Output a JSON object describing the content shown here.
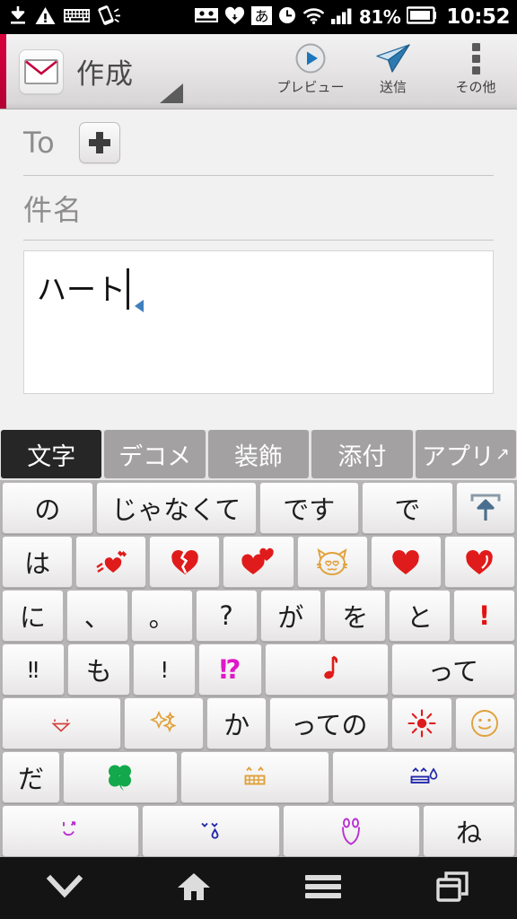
{
  "statusbar": {
    "left_icons": [
      {
        "name": "download-icon"
      },
      {
        "name": "warning-icon"
      },
      {
        "name": "keyboard-icon"
      },
      {
        "name": "vibrate-icon"
      }
    ],
    "right_icons": [
      {
        "name": "voicemail-icon"
      },
      {
        "name": "heart-icon"
      },
      {
        "name": "ime-japanese-icon",
        "glyph": "あ"
      },
      {
        "name": "alarm-clock-icon"
      },
      {
        "name": "wifi-icon"
      },
      {
        "name": "signal-icon"
      }
    ],
    "battery_percent": "81%",
    "clock": "10:52"
  },
  "appbar": {
    "title": "作成",
    "accent_color": "#d8003c",
    "actions": [
      {
        "label": "プレビュー",
        "icon": "play-circle-icon"
      },
      {
        "label": "送信",
        "icon": "send-paperplane-icon"
      },
      {
        "label": "その他",
        "icon": "overflow-dots-icon"
      }
    ]
  },
  "compose": {
    "to_label": "To",
    "to_value": "",
    "add_recipient_label": "+",
    "subject_placeholder": "件名",
    "subject_value": "",
    "body_value": "ハート"
  },
  "ime": {
    "tabs": [
      {
        "label": "文字",
        "active": true
      },
      {
        "label": "デコメ",
        "active": false
      },
      {
        "label": "装飾",
        "active": false
      },
      {
        "label": "添付",
        "active": false
      },
      {
        "label": "アプリ",
        "arrow": "↗",
        "active": false
      }
    ],
    "suggestions": [
      {
        "label": "の",
        "flex": 1.55
      },
      {
        "label": "じゃなくて",
        "flex": 2.75
      },
      {
        "label": "です",
        "flex": 1.7
      },
      {
        "label": "で",
        "flex": 1.55
      },
      {
        "label": "",
        "icon": "expand-candidates-icon",
        "flex": 1.0
      }
    ],
    "rows": [
      [
        {
          "label": "は",
          "type": "text",
          "flex": 1
        },
        {
          "label": "",
          "type": "icon",
          "icon": "heart-motion-icon",
          "flex": 1
        },
        {
          "label": "",
          "type": "icon",
          "icon": "broken-heart-icon",
          "flex": 1
        },
        {
          "label": "",
          "type": "icon",
          "icon": "two-hearts-icon",
          "flex": 1
        },
        {
          "label": "",
          "type": "icon",
          "icon": "cat-heart-eyes-icon",
          "flex": 1
        },
        {
          "label": "",
          "type": "icon",
          "icon": "red-heart-icon",
          "flex": 1
        },
        {
          "label": "",
          "type": "icon",
          "icon": "heart-swirl-icon",
          "flex": 1
        }
      ],
      [
        {
          "label": "に",
          "type": "text",
          "flex": 1
        },
        {
          "label": "、",
          "type": "text",
          "flex": 1
        },
        {
          "label": "。",
          "type": "text",
          "flex": 1
        },
        {
          "label": "?",
          "type": "text",
          "flex": 1
        },
        {
          "label": "が",
          "type": "text",
          "flex": 1
        },
        {
          "label": "を",
          "type": "text",
          "flex": 1
        },
        {
          "label": "と",
          "type": "text",
          "flex": 1
        },
        {
          "label": "!",
          "type": "text",
          "color": "red",
          "flex": 1
        }
      ],
      [
        {
          "label": "‼",
          "type": "text",
          "flex": 1
        },
        {
          "label": "も",
          "type": "text",
          "flex": 1
        },
        {
          "label": "!",
          "type": "text",
          "flex": 1
        },
        {
          "label": "⁉",
          "type": "text",
          "color": "magenta",
          "flex": 1
        },
        {
          "label": "",
          "type": "icon",
          "icon": "music-note-icon",
          "flex": 2
        },
        {
          "label": "って",
          "type": "text",
          "flex": 2
        }
      ],
      [
        {
          "label": "",
          "type": "icon",
          "icon": "red-tongue-face-icon",
          "flex": 2
        },
        {
          "label": "",
          "type": "icon",
          "icon": "sparkles-icon",
          "flex": 1.33
        },
        {
          "label": "か",
          "type": "text",
          "flex": 1
        },
        {
          "label": "っての",
          "type": "text",
          "flex": 2
        },
        {
          "label": "",
          "type": "icon",
          "icon": "red-sun-burst-icon",
          "flex": 1
        },
        {
          "label": "",
          "type": "icon",
          "icon": "orange-smiley-icon",
          "flex": 1
        }
      ],
      [
        {
          "label": "だ",
          "type": "text",
          "flex": 1
        },
        {
          "label": "",
          "type": "icon",
          "icon": "four-leaf-clover-icon",
          "flex": 2
        },
        {
          "label": "",
          "type": "icon",
          "icon": "gold-grin-face-icon",
          "flex": 2.6
        },
        {
          "label": "",
          "type": "icon",
          "icon": "blue-sweat-face-icon",
          "flex": 3.2
        }
      ],
      [
        {
          "label": "",
          "type": "icon",
          "icon": "purple-wink-face-icon",
          "flex": 2.4
        },
        {
          "label": "",
          "type": "icon",
          "icon": "blue-tear-face-icon",
          "flex": 2.4
        },
        {
          "label": "",
          "type": "icon",
          "icon": "purple-tulip-icon",
          "flex": 2.4
        },
        {
          "label": "ね",
          "type": "text",
          "flex": 1.6
        }
      ]
    ]
  },
  "navbar": {
    "buttons": [
      {
        "name": "hide-keyboard-icon"
      },
      {
        "name": "home-icon"
      },
      {
        "name": "menu-icon"
      },
      {
        "name": "recent-apps-icon"
      }
    ]
  }
}
